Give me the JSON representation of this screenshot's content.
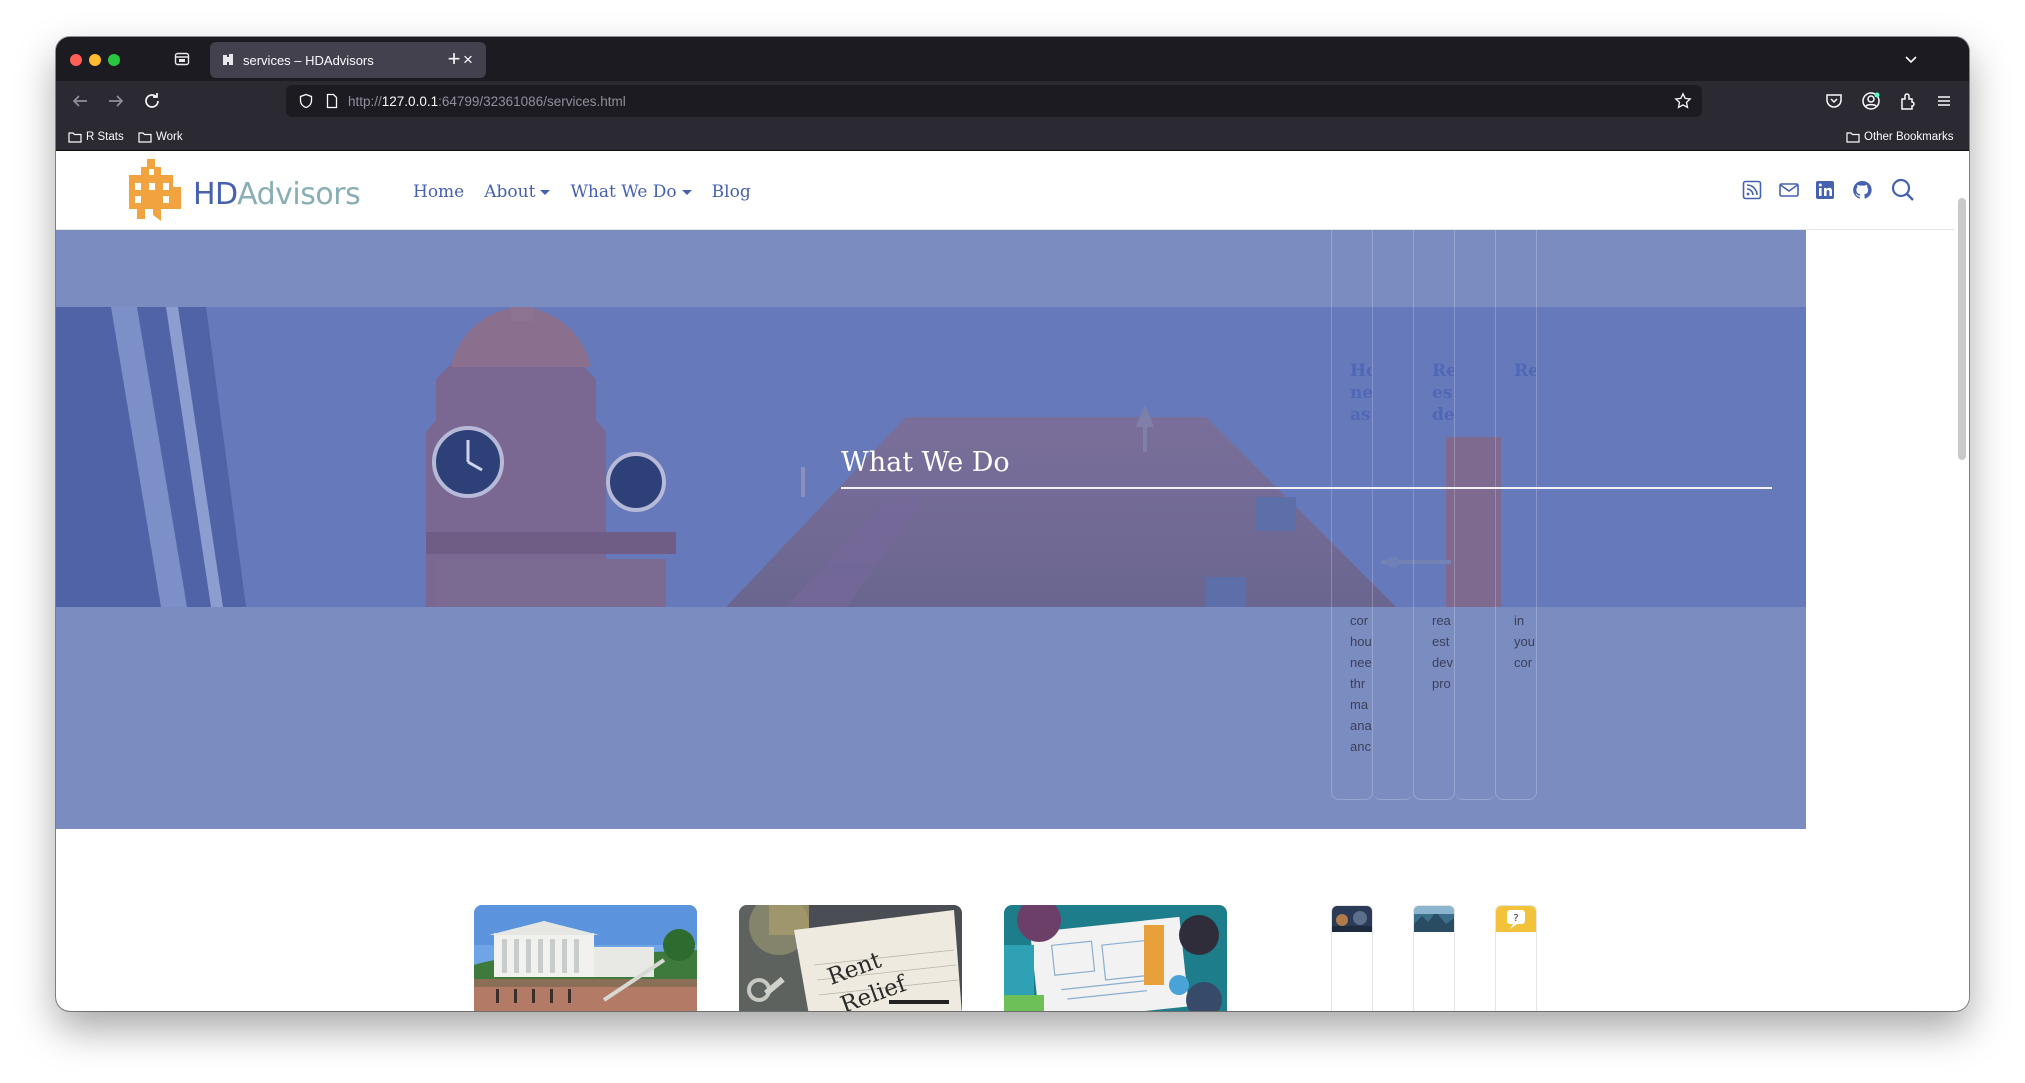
{
  "browser": {
    "tab_title": "services – HDAdvisors",
    "url_prefix": "http://",
    "url_host": "127.0.0.1",
    "url_rest": ":64799/32361086/services.html",
    "bookmarks": [
      "R Stats",
      "Work"
    ],
    "other_bookmarks": "Other Bookmarks"
  },
  "site": {
    "logo_hd": "HD",
    "logo_advisors": "Advisors",
    "nav": [
      {
        "label": "Home"
      },
      {
        "label": "About"
      },
      {
        "label": "What We Do"
      },
      {
        "label": "Blog"
      }
    ]
  },
  "hero": {
    "title": "What We Do"
  },
  "fragments": [
    {
      "head": [
        "Ho",
        "ne",
        "as"
      ],
      "body": [
        "cor",
        "hou",
        "nee",
        "thr",
        "ma",
        "ana",
        "anc"
      ]
    },
    {
      "head": [
        "Re",
        "es",
        "de"
      ],
      "body": [
        "rea",
        "est",
        "dev",
        "pro"
      ]
    },
    {
      "head": [
        "Re"
      ],
      "body": [
        "in",
        "you",
        "cor"
      ]
    }
  ],
  "cards": [
    {
      "image": "capitol-building"
    },
    {
      "image": "rent-relief-notepad"
    },
    {
      "image": "blueprint-meeting"
    }
  ]
}
